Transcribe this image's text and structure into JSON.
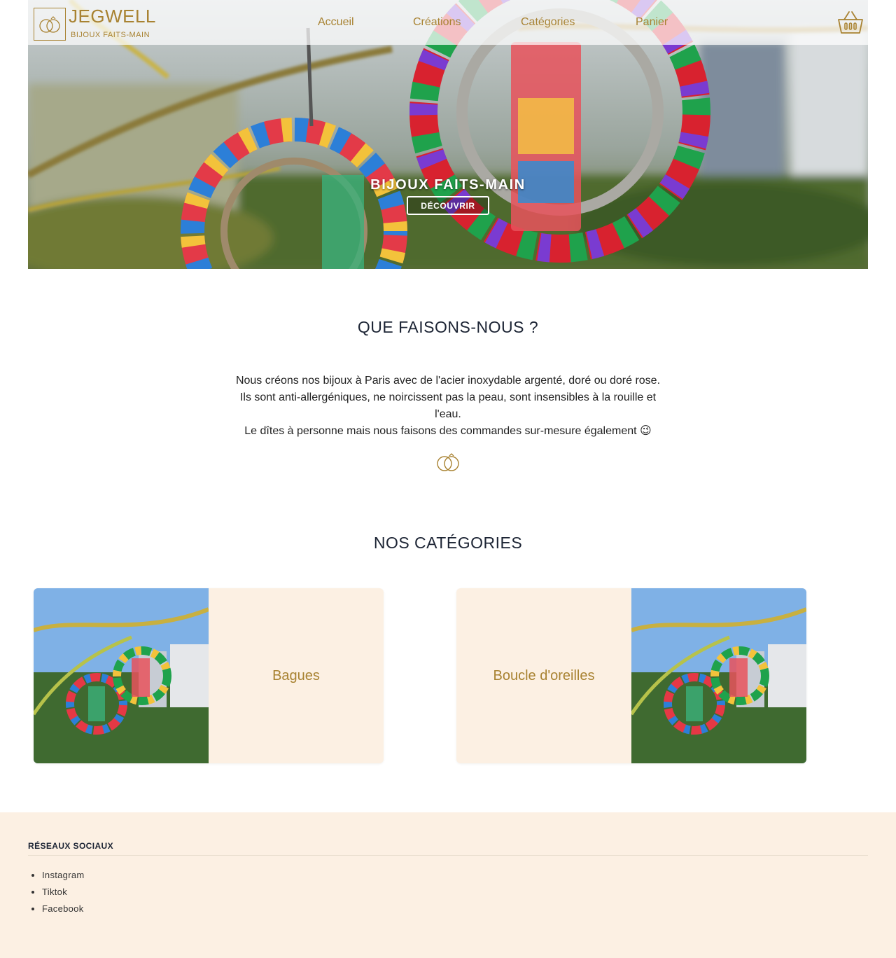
{
  "header": {
    "brand": "JEGWELL",
    "tagline": "BIJOUX FAITS-MAIN",
    "nav": [
      "Accueil",
      "Créations",
      "Catégories",
      "Panier"
    ],
    "cart_icon": "basket-icon",
    "logo_icon": "rings-icon"
  },
  "hero": {
    "title": "BIJOUX FAITS-MAIN",
    "button": "DÉCOUVRIR"
  },
  "about": {
    "title": "QUE FAISONS-NOUS ?",
    "paragraph1": "Nous créons nos bijoux à Paris avec de l'acier inoxydable argenté, doré ou doré rose. Ils sont anti-allergéniques, ne noircissent pas la peau, sont insensibles à la rouille et l'eau.",
    "paragraph2": "Le dîtes à personne mais nous faisons des commandes sur-mesure également 😉"
  },
  "categories": {
    "title": "NOS CATÉGORIES",
    "items": [
      {
        "label": "Bagues"
      },
      {
        "label": "Boucle d'oreilles"
      }
    ]
  },
  "footer": {
    "title": "RÉSEAUX SOCIAUX",
    "links": [
      "Instagram",
      "Tiktok",
      "Facebook"
    ]
  },
  "colors": {
    "accent": "#a88231",
    "cream": "#fcf0e3",
    "heading": "#1c2434"
  }
}
